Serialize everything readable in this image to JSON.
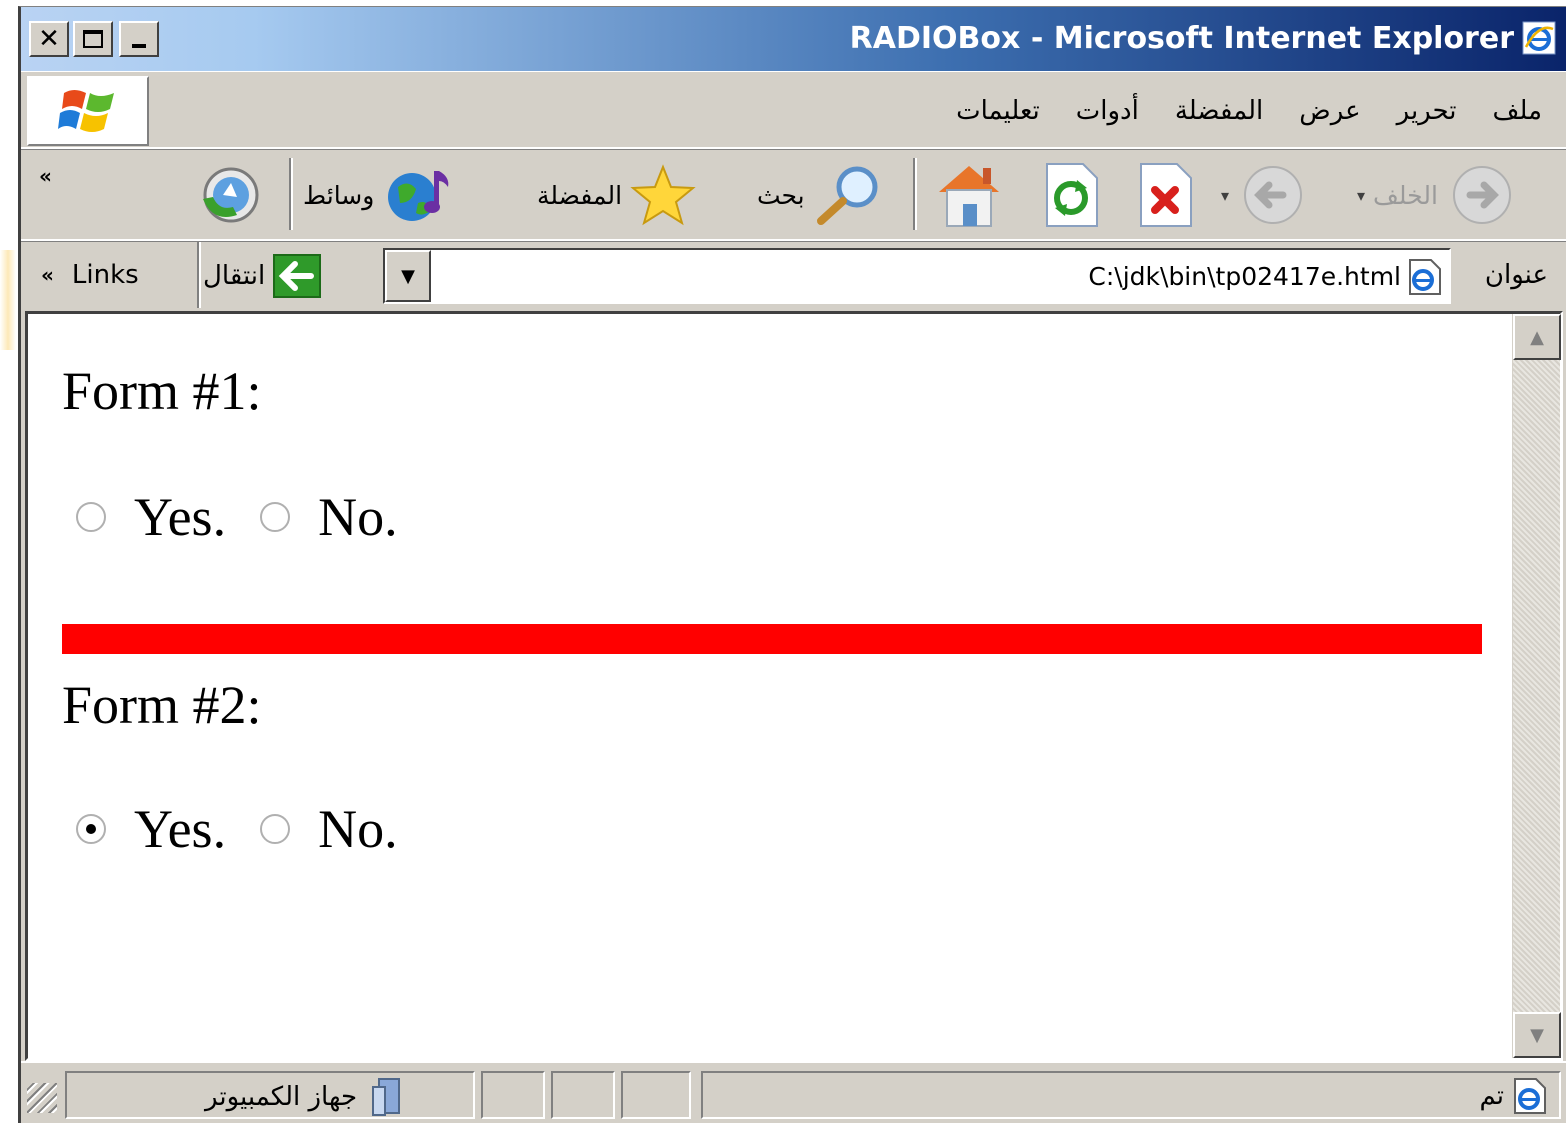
{
  "window": {
    "title": "RADIOBox - Microsoft Internet Explorer"
  },
  "menu": {
    "items": [
      "ملف",
      "تحرير",
      "عرض",
      "المفضلة",
      "أدوات",
      "تعليمات"
    ]
  },
  "toolbar": {
    "back_label": "الخلف",
    "search_label": "بحث",
    "favorites_label": "المفضلة",
    "media_label": "وسائط",
    "chevron": "«"
  },
  "address": {
    "label": "عنوان",
    "value": "C:\\jdk\\bin\\tp02417e.html",
    "go_label": "انتقال",
    "links_label": "Links",
    "chevron": "«"
  },
  "content": {
    "form1": {
      "title": "Form #1:",
      "yes_label": "Yes.",
      "no_label": "No.",
      "yes_checked": false,
      "no_checked": false
    },
    "separator_color": "#ff0000",
    "form2": {
      "title": "Form #2:",
      "yes_label": "Yes.",
      "no_label": "No.",
      "yes_checked": true,
      "no_checked": false
    }
  },
  "status": {
    "done_text": "تم",
    "zone_text": "جهاز الكمبيوتر"
  }
}
